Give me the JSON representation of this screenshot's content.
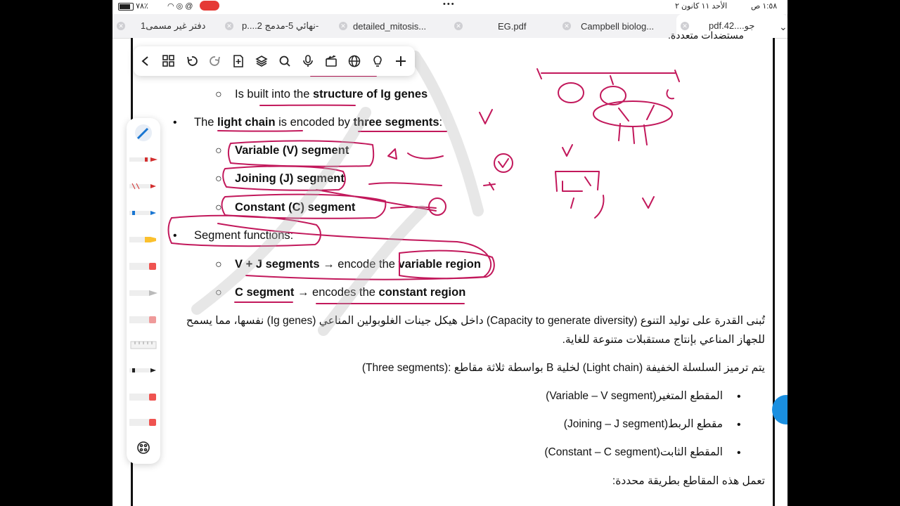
{
  "status": {
    "time": "١:٥٨ ص",
    "date": "الأحد ١١ كانون ٢",
    "battery": "٧٨٪",
    "dots": "•••"
  },
  "tabs": [
    {
      "label": "دفتر غير مسمى1"
    },
    {
      "label": "p....2 نهائي 5-مدمج-"
    },
    {
      "label": "detailed_mitosis..."
    },
    {
      "label": "EG.pdf"
    },
    {
      "label": "Campbell biolog..."
    },
    {
      "label": "pdf.جو....42"
    }
  ],
  "top_text": "مستضدات متعددة.",
  "content": {
    "l1_a": "Is ",
    "l1_b": "built",
    " l1_c": "",
    "l1_c2": " into the ",
    "l1_d": "structure of Ig genes",
    "l2_a": "The ",
    "l2_b": "light chain",
    "l2_c": " is encoded by ",
    "l2_d": "three segments",
    "l2_e": ":",
    "l3": "Variable (V) segment",
    "l4": "Joining (J) segment",
    "l5": "Constant (C) segment",
    "l6": "Segment functions:",
    "l7_a": "V + J segments",
    "l7_b": " → encode the ",
    "l7_c": "variable region",
    "l8_a": "C segment",
    "l8_b": " → encodes the ",
    "l8_c": "constant region"
  },
  "arabic": {
    "p1_line1": "تُبنى القدرة على توليد التنوع (Capacity to generate diversity) داخل هيكل جينات الغلوبولين المناعي (Ig genes) نفسها، مما يسمح",
    "p1_line2": "للجهاز المناعي بإنتاج مستقبلات متنوعة للغاية.",
    "p2": "يتم ترميز السلسلة الخفيفة (Light chain) لخلية B بواسطة ثلاثة مقاطع :(Three segments)",
    "b1": "المقطع المتغير(Variable – V segment)",
    "b2": "مقطع الربط(Joining – J segment)",
    "b3": "المقطع الثابت(Constant – C segment)",
    "p3": "تعمل هذه المقاطع بطريقة محددة:"
  },
  "toolbar_icons": [
    "back-icon",
    "grid-icon",
    "undo-icon",
    "redo-icon",
    "add-page-icon",
    "layers-icon",
    "search-icon",
    "microphone-icon",
    "clapper-icon",
    "globe-icon",
    "lightbulb-icon",
    "plus-icon"
  ],
  "side_tools": [
    "pen-tool",
    "red-pen-tool",
    "red-marker-tool",
    "blue-pen-tool",
    "yellow-highlighter-tool",
    "eraser-tool",
    "pencil-tool",
    "gray-pen-tool",
    "ruler-tool",
    "black-pen-tool",
    "gray-marker-tool",
    "gray-marker-tool-2",
    "palette-icon"
  ],
  "colors": {
    "ink": "#c2185b",
    "accent": "#1a8fe0"
  }
}
